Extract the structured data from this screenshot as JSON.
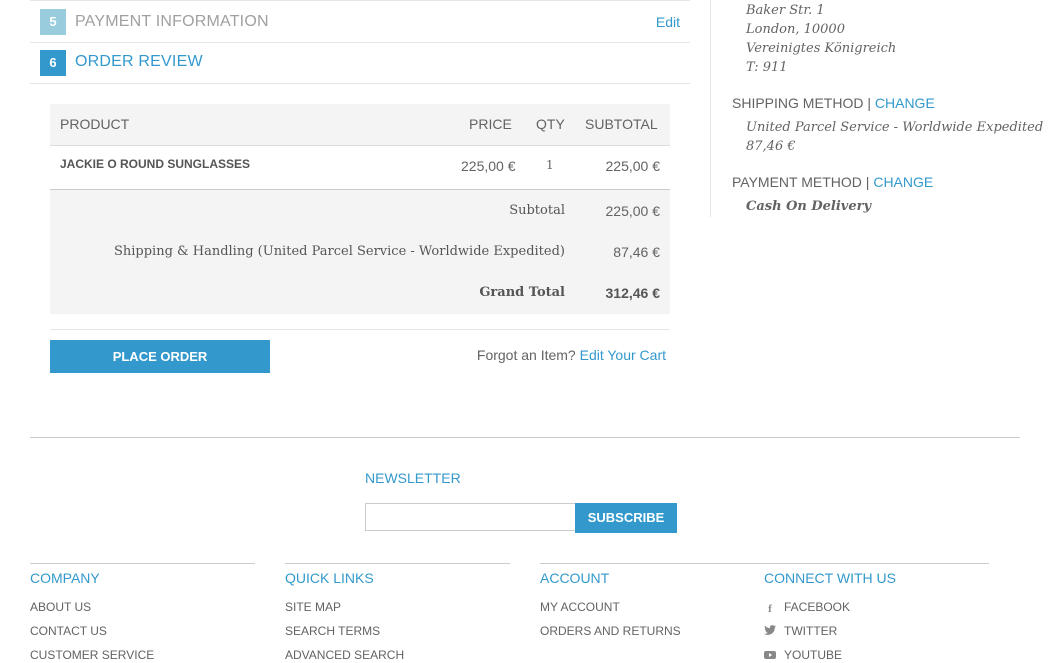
{
  "steps": [
    {
      "number": "5",
      "title": "PAYMENT INFORMATION",
      "edit_label": "Edit"
    },
    {
      "number": "6",
      "title": "ORDER REVIEW"
    }
  ],
  "review": {
    "headers": {
      "product": "PRODUCT",
      "price": "PRICE",
      "qty": "QTY",
      "subtotal": "SUBTOTAL"
    },
    "item": {
      "name": "JACKIE O ROUND SUNGLASSES",
      "price": "225,00 €",
      "qty": "1",
      "subtotal": "225,00 €"
    },
    "totals": [
      {
        "label": "Subtotal",
        "value": "225,00 €"
      },
      {
        "label": "Shipping & Handling (United Parcel Service - Worldwide Expedited)",
        "value": "87,46 €"
      },
      {
        "label": "Grand Total",
        "value": "312,46 €"
      }
    ],
    "place_order_label": "PLACE ORDER",
    "forgot_text": "Forgot an Item?",
    "edit_cart_label": "Edit Your Cart"
  },
  "sidebar": {
    "address_lines": [
      "Baker Str. 1",
      "London, 10000",
      "Vereinigtes Königreich",
      "T: 911"
    ],
    "shipping_method_label": "SHIPPING METHOD",
    "shipping_change_label": "CHANGE",
    "shipping_method_lines": [
      "United Parcel Service - Worldwide Expedited",
      "87,46 €"
    ],
    "payment_method_label": "PAYMENT METHOD",
    "payment_change_label": "CHANGE",
    "payment_method_value": "Cash On Delivery",
    "separator": "|"
  },
  "footer": {
    "newsletter_title": "NEWSLETTER",
    "newsletter_placeholder": "",
    "subscribe_label": "SUBSCRIBE",
    "columns": [
      {
        "title": "COMPANY",
        "links": [
          "ABOUT US",
          "CONTACT US",
          "CUSTOMER SERVICE"
        ]
      },
      {
        "title": "QUICK LINKS",
        "links": [
          "SITE MAP",
          "SEARCH TERMS",
          "ADVANCED SEARCH"
        ]
      },
      {
        "title": "ACCOUNT",
        "links": [
          "MY ACCOUNT",
          "ORDERS AND RETURNS"
        ]
      },
      {
        "title": "CONNECT WITH US",
        "links": [
          "FACEBOOK",
          "TWITTER",
          "YOUTUBE"
        ],
        "icons": [
          "facebook-icon",
          "twitter-icon",
          "youtube-icon"
        ]
      }
    ]
  },
  "colors": {
    "accent": "#3399cc",
    "step_inactive": "#99ccdd",
    "text": "#636363",
    "table_bg": "#f4f4f4"
  }
}
